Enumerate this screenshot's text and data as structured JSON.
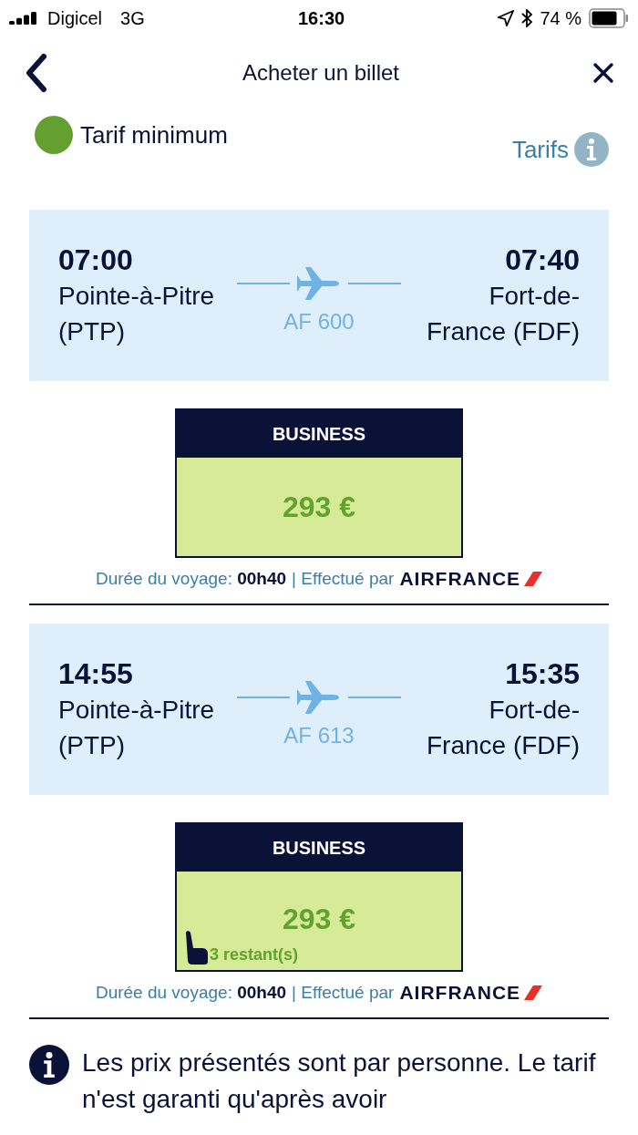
{
  "status_bar": {
    "carrier": "Digicel",
    "network": "3G",
    "time": "16:30",
    "battery": "74 %"
  },
  "header": {
    "title": "Acheter un billet"
  },
  "legend": {
    "label": "Tarif minimum",
    "color": "#64a030"
  },
  "tarifs_link": "Tarifs",
  "flights": [
    {
      "depart_time": "07:00",
      "depart_city": "Pointe-à-Pitre (PTP)",
      "flight_no": "AF 600",
      "arrive_time": "07:40",
      "arrive_city": "Fort-de-France (FDF)",
      "fare": {
        "cabin": "BUSINESS",
        "price": "293 €",
        "minimum": true
      },
      "duration_label": "Durée du voyage:",
      "duration": "00h40",
      "operated_label": "| Effectué par",
      "airline": "AIRFRANCE"
    },
    {
      "depart_time": "14:55",
      "depart_city": "Pointe-à-Pitre (PTP)",
      "flight_no": "AF 613",
      "arrive_time": "15:35",
      "arrive_city": "Fort-de-France (FDF)",
      "fare": {
        "cabin": "BUSINESS",
        "price": "293 €",
        "minimum": true,
        "seats_left": "3 restant(s)"
      },
      "duration_label": "Durée du voyage:",
      "duration": "00h40",
      "operated_label": "| Effectué par",
      "airline": "AIRFRANCE"
    }
  ],
  "info": {
    "text": "Les prix présentés sont par personne. Le tarif n'est garanti qu'après avoir"
  }
}
